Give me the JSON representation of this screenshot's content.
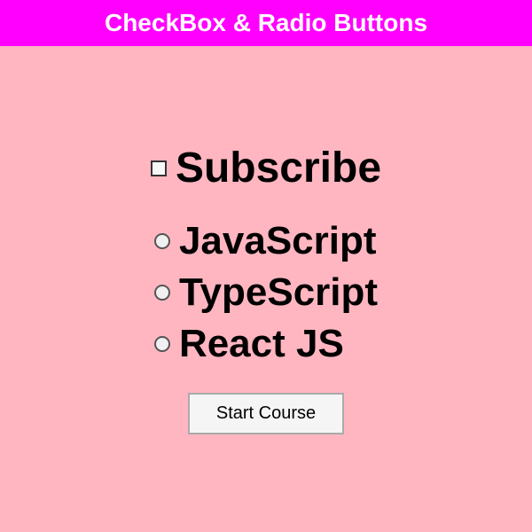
{
  "header": {
    "title": "CheckBox & Radio Buttons",
    "bg_color": "#FF00FF"
  },
  "main": {
    "bg_color": "#FFB6C1",
    "subscribe_label": "Subscribe",
    "radio_options": [
      {
        "label": "JavaScript",
        "value": "javascript"
      },
      {
        "label": "TypeScript",
        "value": "typescript"
      },
      {
        "label": "React JS",
        "value": "reactjs"
      }
    ],
    "start_button_label": "Start Course"
  }
}
